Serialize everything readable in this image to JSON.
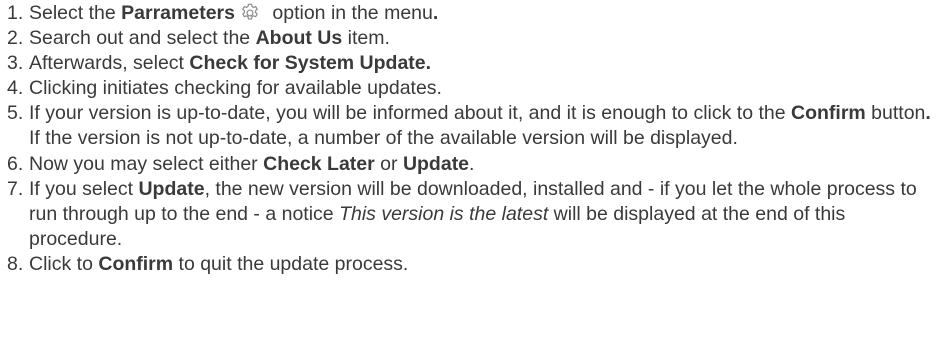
{
  "steps": [
    {
      "num": "1.",
      "parts": [
        {
          "t": "Select the "
        },
        {
          "t": "Parrameters",
          "b": true
        },
        {
          "icon": "gear-icon"
        },
        {
          "t": " option in the menu"
        },
        {
          "t": ".",
          "b": true
        }
      ]
    },
    {
      "num": "2.",
      "parts": [
        {
          "t": "Search out and select the "
        },
        {
          "t": "About Us",
          "b": true
        },
        {
          "t": " item."
        }
      ]
    },
    {
      "num": "3.",
      "parts": [
        {
          "t": "Afterwards, select "
        },
        {
          "t": "Check for System Update.",
          "b": true
        }
      ]
    },
    {
      "num": "4.",
      "parts": [
        {
          "t": "Clicking initiates checking for available updates."
        }
      ]
    },
    {
      "num": "5.",
      "parts": [
        {
          "t": "If your version is up-to-date, you will be informed about it, and it is enough to click to the "
        },
        {
          "t": "Confirm",
          "b": true
        },
        {
          "t": " button"
        },
        {
          "t": ".",
          "b": true
        },
        {
          "br": true
        },
        {
          "t": "If the version is not up-to-date, a number of the available version will be displayed."
        }
      ]
    },
    {
      "num": "6.",
      "parts": [
        {
          "t": "Now you may select either "
        },
        {
          "t": "Check Later",
          "b": true
        },
        {
          "t": " or "
        },
        {
          "t": "Update",
          "b": true
        },
        {
          "t": "."
        }
      ]
    },
    {
      "num": "7.",
      "parts": [
        {
          "t": "If you select "
        },
        {
          "t": "Update",
          "b": true
        },
        {
          "t": ", the new version will be downloaded, installed and - if you let the whole process to run through up to the end - a notice "
        },
        {
          "t": "This version is the latest",
          "i": true
        },
        {
          "t": " will be displayed at the end of this procedure."
        }
      ]
    },
    {
      "num": "8.",
      "parts": [
        {
          "t": "Click to "
        },
        {
          "t": "Confirm",
          "b": true
        },
        {
          "t": " to quit the update process."
        }
      ]
    }
  ]
}
